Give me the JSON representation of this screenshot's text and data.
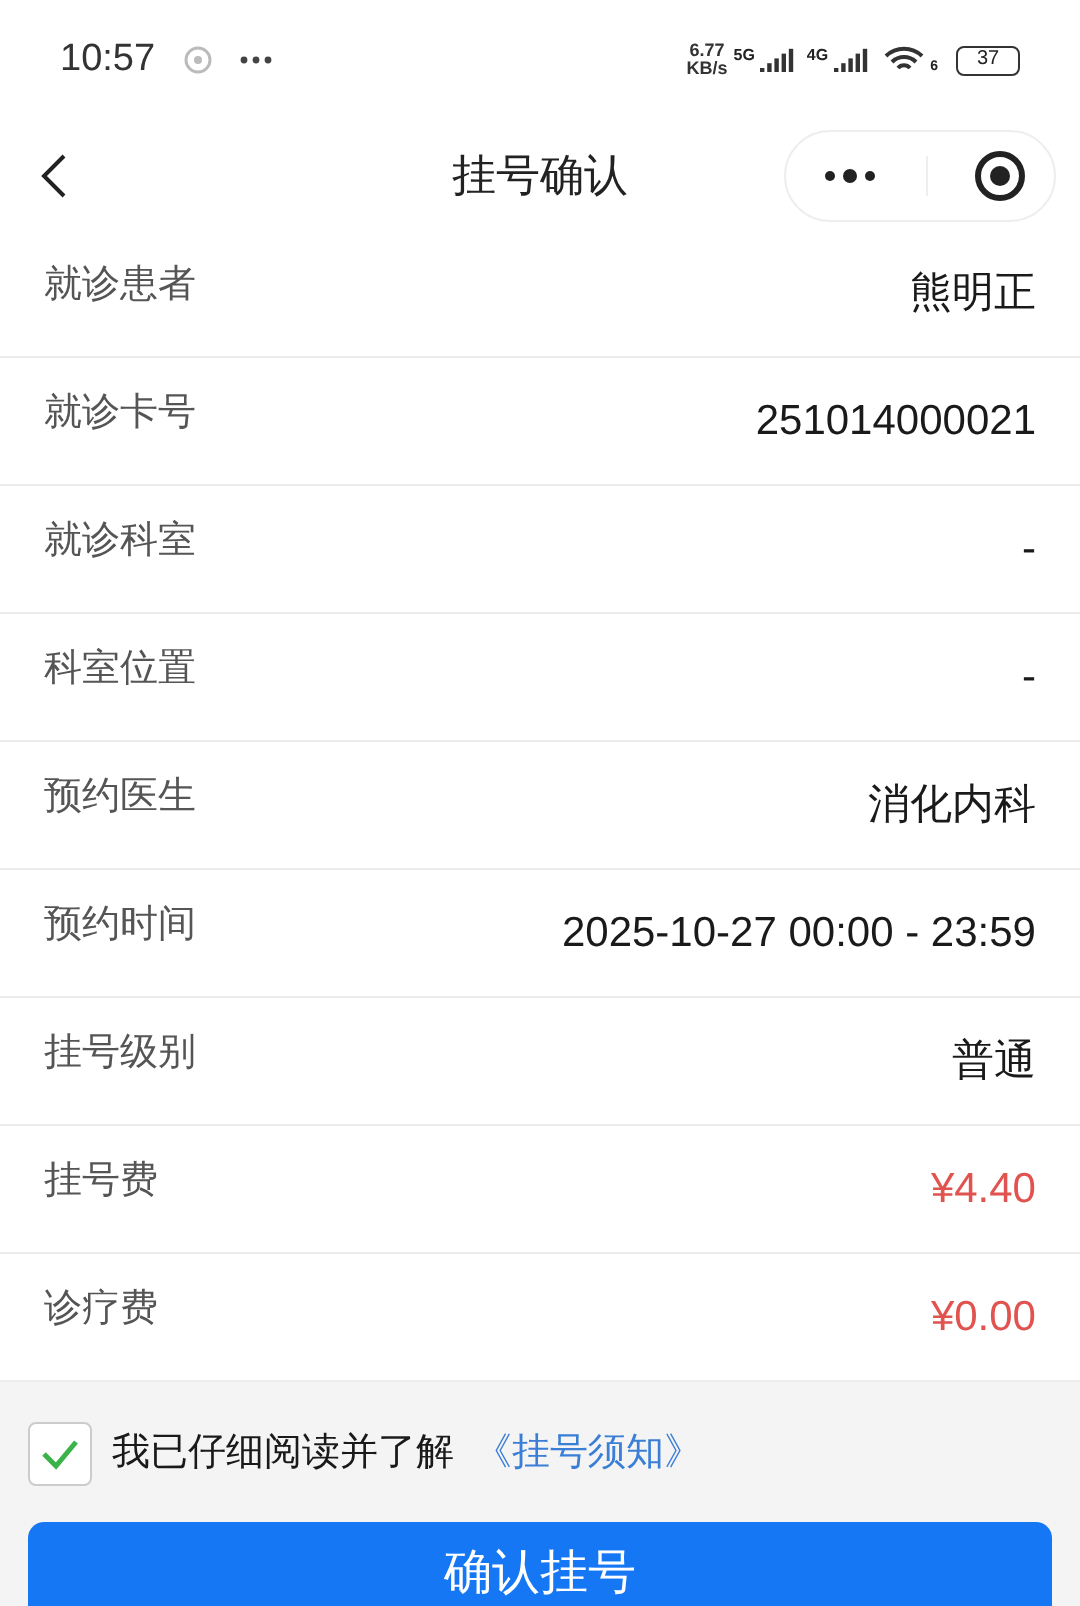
{
  "status_bar": {
    "time": "10:57",
    "speed_value": "6.77",
    "speed_unit": "KB/s",
    "network_1": "5G",
    "network_2": "4G",
    "wifi_label": "6",
    "battery": "37"
  },
  "nav": {
    "title": "挂号确认"
  },
  "rows": [
    {
      "label": "就诊患者",
      "value": "熊明正",
      "kind": "plain"
    },
    {
      "label": "就诊卡号",
      "value": "251014000021",
      "kind": "plain"
    },
    {
      "label": "就诊科室",
      "value": "-",
      "kind": "plain"
    },
    {
      "label": "科室位置",
      "value": "-",
      "kind": "plain"
    },
    {
      "label": "预约医生",
      "value": "消化内科",
      "kind": "plain"
    },
    {
      "label": "预约时间",
      "value": "2025-10-27 00:00 - 23:59",
      "kind": "plain"
    },
    {
      "label": "挂号级别",
      "value": "普通",
      "kind": "plain"
    },
    {
      "label": "挂号费",
      "value": "¥4.40",
      "kind": "price"
    },
    {
      "label": "诊疗费",
      "value": "¥0.00",
      "kind": "price"
    }
  ],
  "agreement": {
    "checked": true,
    "text": "我已仔细阅读并了解",
    "link": "《挂号须知》"
  },
  "confirm_button": "确认挂号"
}
